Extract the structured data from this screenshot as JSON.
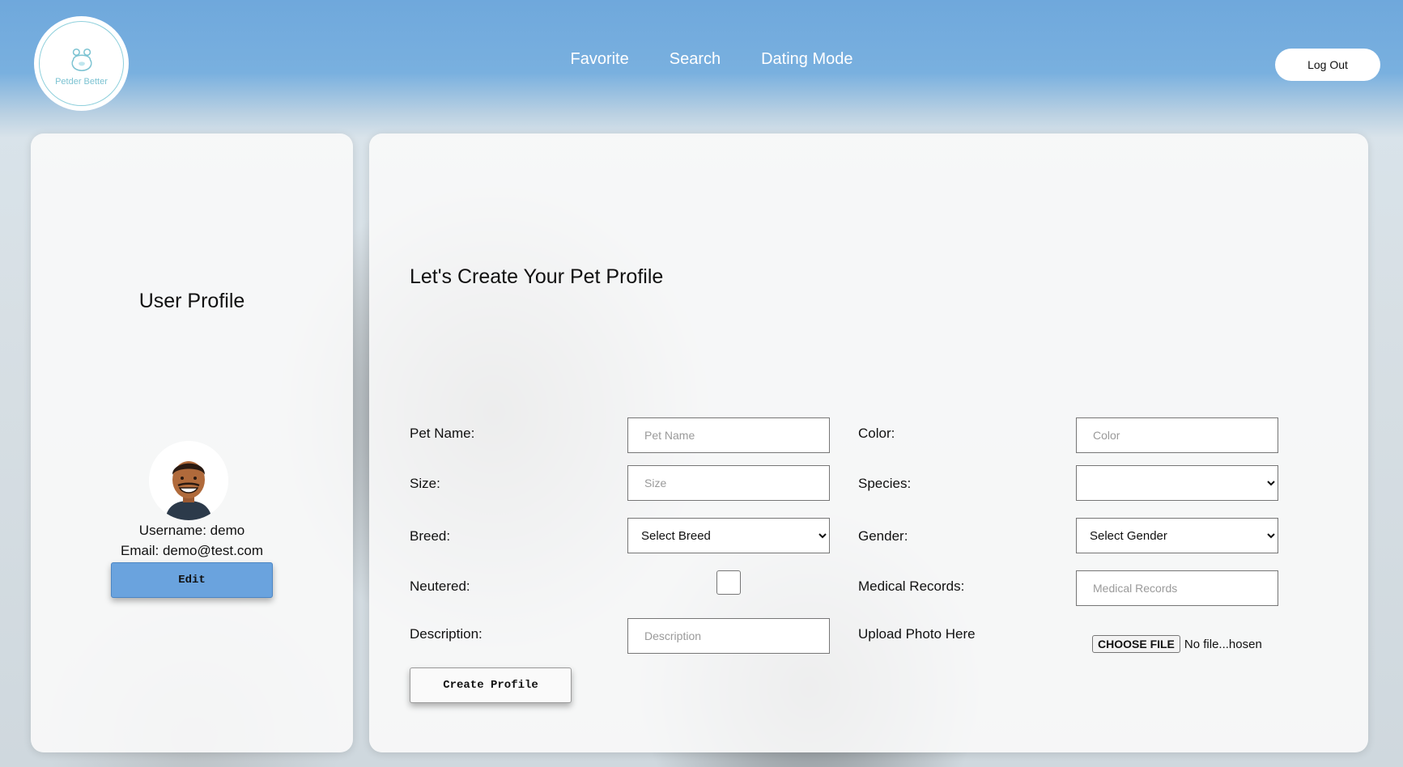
{
  "brand": {
    "logo_text": "Petder Better",
    "accent_color": "#6aa3de"
  },
  "nav": {
    "items": [
      {
        "label": "Favorite"
      },
      {
        "label": "Search"
      },
      {
        "label": "Dating Mode"
      }
    ],
    "logout_label": "Log Out"
  },
  "user_profile": {
    "title": "User Profile",
    "username_line": "Username: demo",
    "email_line": "Email: demo@test.com",
    "edit_label": "Edit"
  },
  "pet_form": {
    "title": "Let's Create Your Pet Profile",
    "pet_name": {
      "label": "Pet Name:",
      "placeholder": "Pet Name",
      "value": ""
    },
    "size": {
      "label": "Size:",
      "placeholder": "Size",
      "value": ""
    },
    "breed": {
      "label": "Breed:",
      "selected": "Select Breed"
    },
    "neutered": {
      "label": "Neutered:",
      "checked": false
    },
    "description": {
      "label": "Description:",
      "placeholder": "Description",
      "value": ""
    },
    "color": {
      "label": "Color:",
      "placeholder": "Color",
      "value": ""
    },
    "species": {
      "label": "Species:",
      "selected": ""
    },
    "gender": {
      "label": "Gender:",
      "selected": "Select Gender"
    },
    "medical_records": {
      "label": "Medical Records:",
      "placeholder": "Medical Records",
      "value": ""
    },
    "upload": {
      "label": "Upload Photo Here",
      "button_label": "CHOOSE FILE",
      "status": "No file...hosen"
    },
    "submit_label": "Create Profile"
  }
}
